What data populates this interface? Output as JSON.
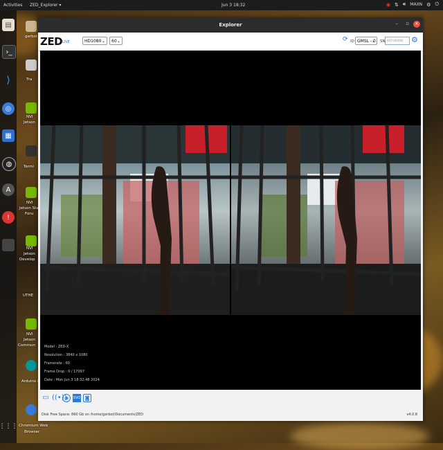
{
  "topbar": {
    "activities": "Activities",
    "app_menu": "ZED_Explorer ▾",
    "clock": "Jun 3 18:32",
    "power_mode": "MAXN"
  },
  "desktop": {
    "labels": [
      "gerbot",
      "Tra",
      "NVI",
      "Jetson",
      "Termi",
      "NVI",
      "Jetson Sta",
      "Foru",
      "NVI",
      "Jetson",
      "Develop",
      "UTHE",
      "NVI",
      "Jetson",
      "Commun",
      "Arduino IDE",
      "Chromium Web",
      "Browser"
    ]
  },
  "window": {
    "title": "Explorer",
    "logo": "ZED",
    "live": "LIVE",
    "resolution": "HD1080",
    "fps": "60",
    "id_label": "ID",
    "id_value": "GMSL - 0",
    "sn_label": "SN",
    "sn_placeholder": "40736408",
    "info": {
      "model": "Model : ZED-X",
      "resolution": "Resolution : 3840 x 1080",
      "framerate": "Framerate : 60",
      "frame_drop": "Frame Drop : 0 / 17097",
      "date": "Date : Mon Jun 3 18:32:48 2024"
    },
    "status": {
      "disk": "Disk Free Space: 860 Gb  on /home/gerbot/Documents/ZED",
      "version": "v4.0.8"
    }
  },
  "colors": {
    "accent": "#2a7ad6",
    "close": "#e9543b"
  }
}
